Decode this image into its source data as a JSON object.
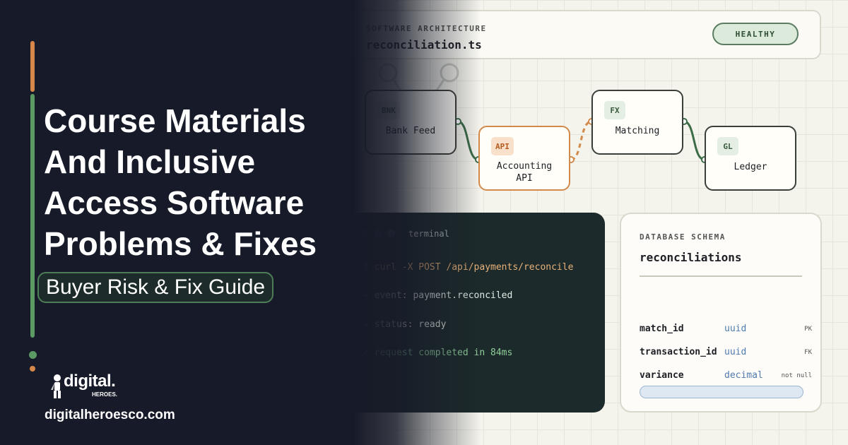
{
  "headline": {
    "lines": [
      "Course Materials",
      "And Inclusive",
      "Access Software",
      "Problems & Fixes"
    ],
    "guide_label": "Buyer Risk & Fix Guide"
  },
  "brand": {
    "logo_word": "digital.",
    "logo_sub": "HEROES.",
    "website": "digitalheroesco.com",
    "colors": {
      "dark_bg": "#171a28",
      "accent_orange": "#d7874a",
      "accent_green": "#5b9a62"
    }
  },
  "architecture": {
    "eyebrow": "SOFTWARE ARCHITECTURE",
    "file_name": "reconciliation.ts",
    "status": "HEALTHY",
    "nodes": [
      {
        "badge": "BNK",
        "label": "Bank Feed"
      },
      {
        "badge": "API",
        "label": "Accounting API"
      },
      {
        "badge": "FX",
        "label": "Matching"
      },
      {
        "badge": "GL",
        "label": "Ledger"
      }
    ]
  },
  "terminal": {
    "title": "terminal",
    "command_prompt": "$",
    "command": "curl -X POST /api/payments/reconcile",
    "event_prefix": "→",
    "event_text": "event: payment.reconciled",
    "status_prefix": "→",
    "status_text": "status: ready",
    "done_prefix": "✓",
    "done_text": "request completed in 84ms"
  },
  "schema": {
    "eyebrow": "DATABASE SCHEMA",
    "table_name": "reconciliations",
    "columns": [
      {
        "name": "match_id",
        "type": "uuid",
        "flag": "PK"
      },
      {
        "name": "transaction_id",
        "type": "uuid",
        "flag": "FK"
      },
      {
        "name": "variance",
        "type": "decimal",
        "flag": "not null"
      }
    ]
  }
}
